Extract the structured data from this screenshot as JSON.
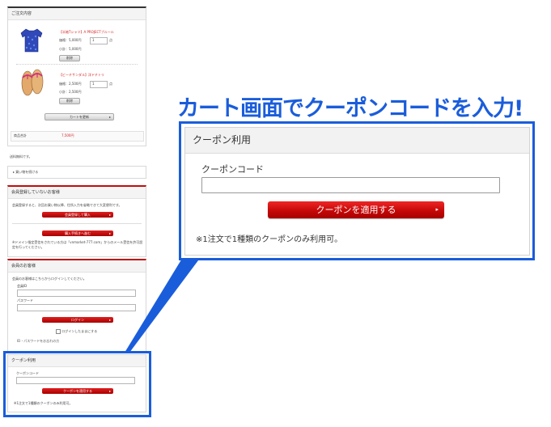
{
  "headline": "カート画面でクーポンコードを入力!",
  "order": {
    "title": "ご注文内容",
    "items": [
      {
        "name": "【半袖Tシャツ】A PROJECTブルール",
        "price_label": "価格：5,000円",
        "qty": "1",
        "qty_unit": "点",
        "subtotal": "小計：5,000円",
        "delete_label": "削除"
      },
      {
        "name": "【ビーチサンダル】洋ドチトリ",
        "price_label": "価格：2,500円",
        "qty": "1",
        "qty_unit": "点",
        "subtotal": "小計：2,500円",
        "delete_label": "削除"
      }
    ],
    "update_button": "カートを更新",
    "total_label": "商品合計",
    "total_value": "7,500円",
    "shipping_note": "送料無料です。",
    "continue_link": "買い物を続ける"
  },
  "guest": {
    "title": "会員登録していないお客様",
    "desc": "会員登録すると、次回お買い物以降、住所入力を省略できて大変便利です。",
    "register_button": "会員登録して購入",
    "proceed_button": "購入手続きへ進む",
    "domain_note": "※ドメイン指定受信をされている方は「vnmarket-777.com」からのメール受信を許可設定を行ってください。"
  },
  "member": {
    "title": "会員のお客様",
    "desc": "会員のお客様はこちらからログインしてください。",
    "id_label": "会員ID",
    "password_label": "パスワード",
    "login_button": "ログイン",
    "keep_login": "ログインしたままにする",
    "forgot": "ID・パスワードをお忘れの方"
  },
  "coupon_small": {
    "title": "クーポン利用",
    "code_label": "クーポンコード",
    "apply_button": "クーポンを適用する",
    "note": "※1注文で1種類のクーポンのみ利用可。"
  },
  "coupon_zoom": {
    "title": "クーポン利用",
    "code_label": "クーポンコード",
    "code_value": "",
    "apply_button": "クーポンを適用する",
    "note": "※1注文で1種類のクーポンのみ利用可。"
  },
  "colors": {
    "accent_blue": "#1a5ddb",
    "button_red": "#c60808",
    "price_red": "#d41f1f"
  }
}
